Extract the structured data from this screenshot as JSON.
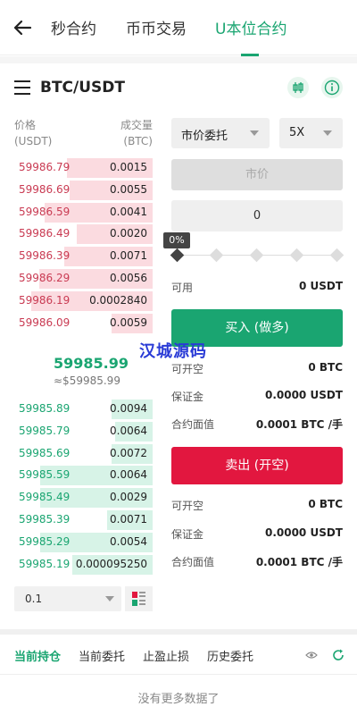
{
  "nav": {
    "tabs": [
      "秒合约",
      "币币交易",
      "U本位合约"
    ],
    "active_tab": "U本位合约"
  },
  "header": {
    "pair": "BTC/USDT"
  },
  "orderbook": {
    "price_label": "价格",
    "price_unit": "(USDT)",
    "qty_label": "成交量",
    "qty_unit": "(BTC)",
    "asks": [
      {
        "price": "59986.79",
        "qty": "0.0015",
        "depth": 0.62
      },
      {
        "price": "59986.69",
        "qty": "0.0055",
        "depth": 0.6
      },
      {
        "price": "59986.59",
        "qty": "0.0041",
        "depth": 0.78
      },
      {
        "price": "59986.49",
        "qty": "0.0020",
        "depth": 0.55
      },
      {
        "price": "59986.39",
        "qty": "0.0071",
        "depth": 0.64
      },
      {
        "price": "59986.29",
        "qty": "0.0056",
        "depth": 0.82
      },
      {
        "price": "59986.19",
        "qty": "0.0002840",
        "depth": 0.88
      },
      {
        "price": "59986.09",
        "qty": "0.0059",
        "depth": 0.3
      }
    ],
    "mid_price": "59985.99",
    "mid_usd": "≈$59985.99",
    "bids": [
      {
        "price": "59985.89",
        "qty": "0.0094",
        "depth": 0.3
      },
      {
        "price": "59985.79",
        "qty": "0.0064",
        "depth": 0.27
      },
      {
        "price": "59985.69",
        "qty": "0.0072",
        "depth": 0.3
      },
      {
        "price": "59985.59",
        "qty": "0.0064",
        "depth": 0.81
      },
      {
        "price": "59985.49",
        "qty": "0.0029",
        "depth": 0.81
      },
      {
        "price": "59985.39",
        "qty": "0.0071",
        "depth": 0.33
      },
      {
        "price": "59985.29",
        "qty": "0.0054",
        "depth": 0.81
      },
      {
        "price": "59985.19",
        "qty": "0.000095250",
        "depth": 0.58
      }
    ],
    "depth_select": "0.1"
  },
  "trade": {
    "order_type": "市价委托",
    "leverage": "5X",
    "price_placeholder": "市价",
    "qty_value": "0",
    "slider_percent": "0%",
    "available_label": "可用",
    "available_value": "0 USDT",
    "buy_label": "买入 (做多)",
    "buy_info": [
      {
        "label": "可开空",
        "value": "0 BTC"
      },
      {
        "label": "保证金",
        "value": "0.0000 USDT"
      },
      {
        "label": "合约面值",
        "value": "0.0001 BTC /手"
      }
    ],
    "sell_label": "卖出 (开空)",
    "sell_info": [
      {
        "label": "可开空",
        "value": "0 BTC"
      },
      {
        "label": "保证金",
        "value": "0.0000 USDT"
      },
      {
        "label": "合约面值",
        "value": "0.0001 BTC /手"
      }
    ]
  },
  "watermark": "汉城源码",
  "bottom": {
    "tabs": [
      "当前持仓",
      "当前委托",
      "止盈止损",
      "历史委托"
    ],
    "active_tab": "当前持仓",
    "empty_text": "没有更多数据了"
  },
  "colors": {
    "accent": "#1aa571",
    "sell": "#e2173f",
    "ask_text": "#c93a52"
  }
}
